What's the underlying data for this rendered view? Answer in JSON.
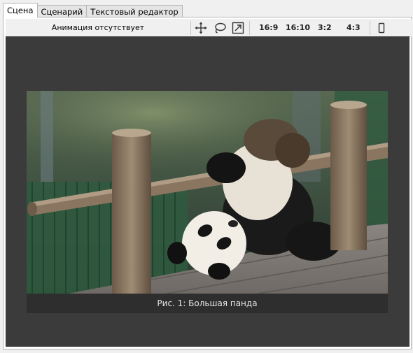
{
  "tabs": [
    {
      "label": "Сцена",
      "active": true
    },
    {
      "label": "Сценарий",
      "active": false
    },
    {
      "label": "Текстовый редактор",
      "active": false
    }
  ],
  "toolbar": {
    "animation_status": "Анимация отсутствует",
    "icons": [
      "move-icon",
      "lasso-icon",
      "resize-icon"
    ],
    "ratios": [
      "16:9",
      "16:10",
      "3:2",
      "4:3"
    ],
    "portrait_icon": "phone-portrait-icon"
  },
  "scene": {
    "background": "#3b3b3b",
    "caption": "Рис. 1: Большая панда"
  }
}
